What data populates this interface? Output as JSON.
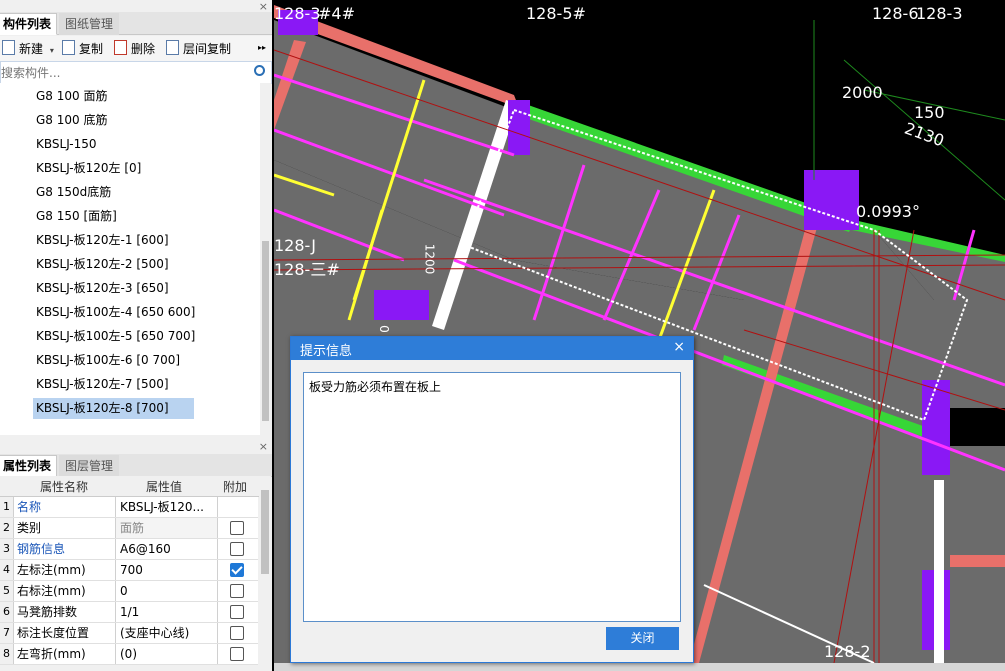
{
  "component_panel": {
    "tabs": [
      "构件列表",
      "图纸管理"
    ],
    "close_glyph": "×",
    "toolbar": {
      "new_label": "新建",
      "copy_label": "复制",
      "delete_label": "删除",
      "floor_copy_label": "层间复制",
      "more_glyph": "▸▸"
    },
    "search_placeholder": "搜索构件...",
    "items": [
      "G8 100 面筋",
      "G8 100 底筋",
      "KBSLJ-150",
      "KBSLJ-板120左 [0]",
      "G8 150d底筋",
      "G8 150 [面筋]",
      "KBSLJ-板120左-1 [600]",
      "KBSLJ-板120左-2 [500]",
      "KBSLJ-板120左-3 [650]",
      "KBSLJ-板100左-4 [650 600]",
      "KBSLJ-板100左-5 [650 700]",
      "KBSLJ-板100左-6 [0 700]",
      "KBSLJ-板120左-7 [500]",
      "KBSLJ-板120左-8 [700]"
    ],
    "selected_item": "KBSLJ-板120左-8 [700]"
  },
  "property_panel": {
    "tabs": [
      "属性列表",
      "图层管理"
    ],
    "close_glyph": "×",
    "headers": {
      "name": "属性名称",
      "value": "属性值",
      "extra": "附加"
    },
    "rows": [
      {
        "num": "1",
        "name": "名称",
        "value": "KBSLJ-板120...",
        "checked": null
      },
      {
        "num": "2",
        "name": "类别",
        "value": "面筋",
        "checked": false
      },
      {
        "num": "3",
        "name": "钢筋信息",
        "value": "A6@160",
        "checked": false
      },
      {
        "num": "4",
        "name": "左标注(mm)",
        "value": "700",
        "checked": true
      },
      {
        "num": "5",
        "name": "右标注(mm)",
        "value": "0",
        "checked": false
      },
      {
        "num": "6",
        "name": "马凳筋排数",
        "value": "1/1",
        "checked": false
      },
      {
        "num": "7",
        "name": "标注长度位置",
        "value": "(支座中心线)",
        "checked": false
      },
      {
        "num": "8",
        "name": "左弯折(mm)",
        "value": "(0)",
        "checked": false
      }
    ]
  },
  "canvas": {
    "labels": {
      "a": "128-3",
      "b": "#4#",
      "c": "128-5#",
      "d": "128-6",
      "e": "128-3",
      "f": "2000",
      "g": "150",
      "h": "2130",
      "i": "0.0993°",
      "j": "128-J",
      "k": "128-三#",
      "l": "128-2",
      "m": "1200",
      "n": "0"
    }
  },
  "dialog": {
    "title": "提示信息",
    "close_glyph": "×",
    "message": "板受力筋必须布置在板上",
    "button_label": "关闭"
  },
  "colors": {
    "dialog_title": "#2e7dd8",
    "selected_row": "#b9d3f0",
    "slab_fill": "#6b6b6b",
    "rebar_magenta": "#ff33ff",
    "beam_red": "#e8706a",
    "beam_green": "#37d637",
    "column_purple": "#8a18f5"
  }
}
